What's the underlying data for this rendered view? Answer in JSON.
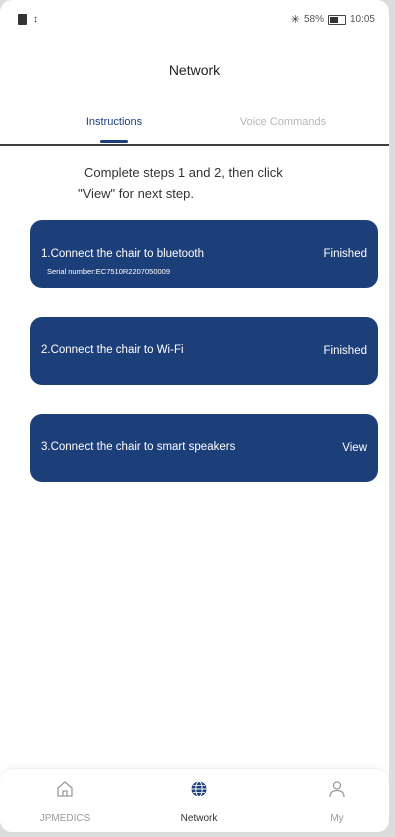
{
  "status_bar": {
    "left_text": "↕",
    "battery": "58%",
    "time": "10:05"
  },
  "header": {
    "title": "Network"
  },
  "tabs": [
    {
      "label": "Instructions",
      "active": true
    },
    {
      "label": "Voice Commands",
      "active": false
    }
  ],
  "instruction": {
    "line1": "Complete steps 1 and 2, then click",
    "line2": "\"View\" for next step."
  },
  "steps": [
    {
      "title": "1.Connect the chair to bluetooth",
      "serial": "Serial number:EC7510R2207050009",
      "action": "Finished"
    },
    {
      "title": "2.Connect the chair to Wi-Fi",
      "action": "Finished"
    },
    {
      "title": "3.Connect the chair to smart speakers",
      "action": "View"
    }
  ],
  "bottom_nav": [
    {
      "label": "JPMEDICS",
      "icon": "home-icon",
      "active": false
    },
    {
      "label": "Network",
      "icon": "globe-icon",
      "active": true
    },
    {
      "label": "My",
      "icon": "person-icon",
      "active": false
    }
  ],
  "colors": {
    "primary": "#1c3f7a",
    "inactive_text": "#b7b7b7"
  }
}
